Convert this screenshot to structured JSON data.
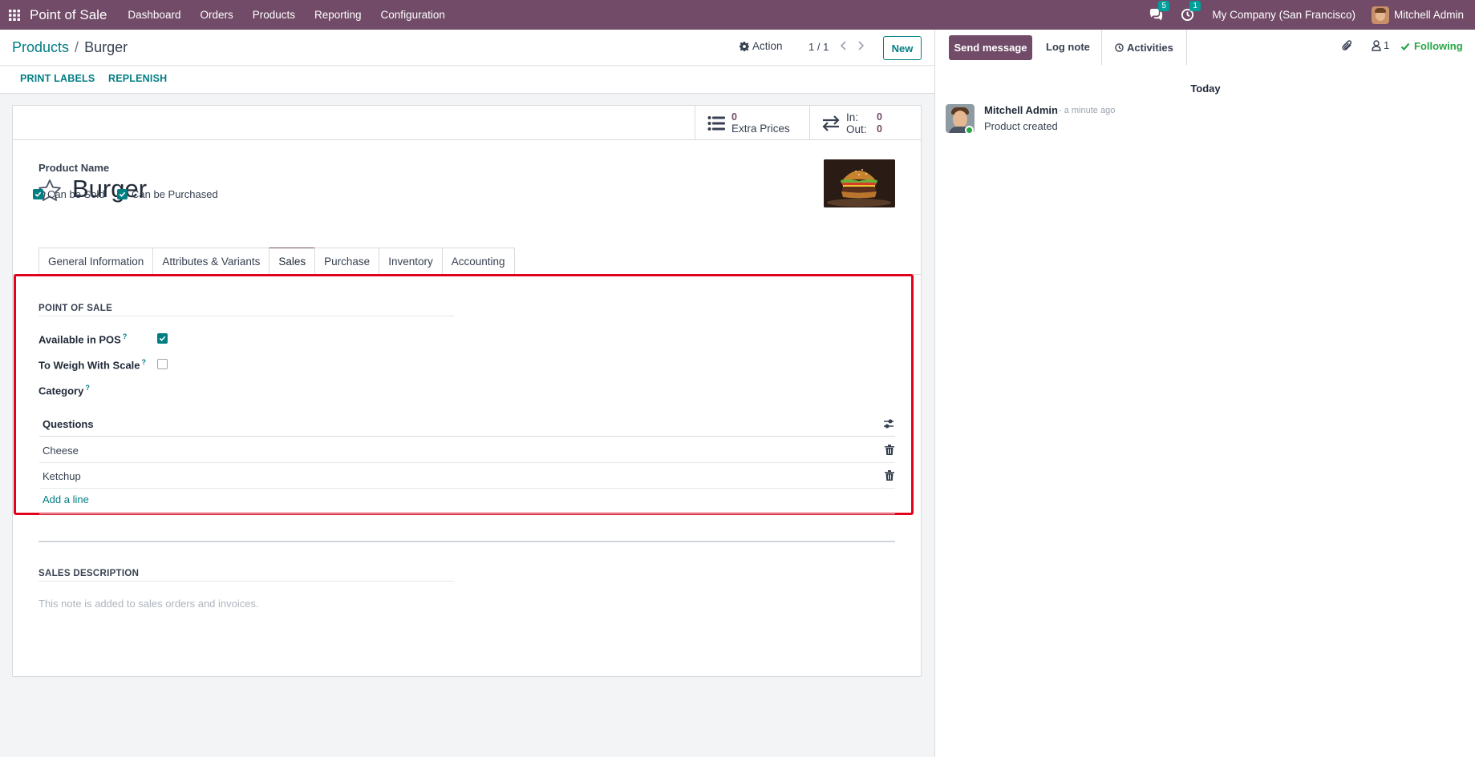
{
  "navbar": {
    "app_name": "Point of Sale",
    "menu": [
      "Dashboard",
      "Orders",
      "Products",
      "Reporting",
      "Configuration"
    ],
    "messages_count": "5",
    "activities_count": "1",
    "company": "My Company (San Francisco)",
    "user": "Mitchell Admin"
  },
  "control": {
    "breadcrumb_parent": "Products",
    "breadcrumb_sep": "/",
    "breadcrumb_current": "Burger",
    "action_label": "Action",
    "pager": "1 / 1",
    "new_label": "New"
  },
  "header_buttons": {
    "print_labels": "PRINT LABELS",
    "replenish": "REPLENISH"
  },
  "stat_buttons": {
    "extra_prices_value": "0",
    "extra_prices_label": "Extra Prices",
    "in_label": "In:",
    "in_value": "0",
    "out_label": "Out:",
    "out_value": "0"
  },
  "product": {
    "name_label": "Product Name",
    "name": "Burger",
    "can_be_sold": "Can be Sold",
    "can_be_purchased": "Can be Purchased"
  },
  "tabs": [
    "General Information",
    "Attributes & Variants",
    "Sales",
    "Purchase",
    "Inventory",
    "Accounting"
  ],
  "active_tab": "Sales",
  "pos_section": {
    "title": "POINT OF SALE",
    "available_in_pos": "Available in POS",
    "to_weigh": "To Weigh With Scale",
    "category": "Category",
    "help_mark": "?",
    "questions_header": "Questions",
    "questions": [
      "Cheese",
      "Ketchup"
    ],
    "add_line": "Add a line"
  },
  "sales_description": {
    "title": "SALES DESCRIPTION",
    "placeholder": "This note is added to sales orders and invoices."
  },
  "chatter": {
    "send_message": "Send message",
    "log_note": "Log note",
    "activities": "Activities",
    "followers_count": "1",
    "following": "Following",
    "today": "Today",
    "message": {
      "author": "Mitchell Admin",
      "time": "- a minute ago",
      "body": "Product created"
    }
  },
  "colors": {
    "brand": "#714b67",
    "accent": "#017e84",
    "highlight": "#e3001b",
    "following": "#28a745"
  }
}
